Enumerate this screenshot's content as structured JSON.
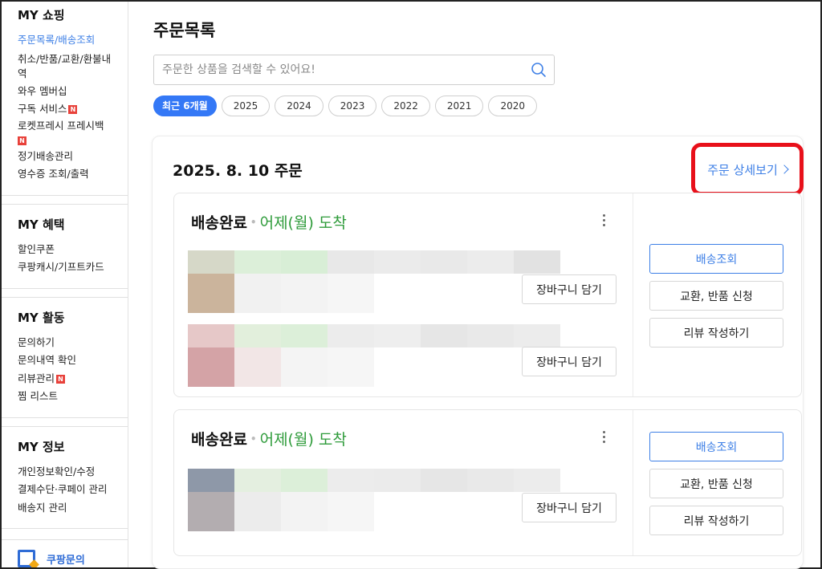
{
  "sidebar": {
    "sections": [
      {
        "title": "MY 쇼핑",
        "items": [
          "주문목록/배송조회",
          "취소/반품/교환/환불내역",
          "와우 멤버십",
          "구독 서비스",
          "로켓프레시 프레시백",
          "정기배송관리",
          "영수증 조회/출력"
        ]
      },
      {
        "title": "MY 혜택",
        "items": [
          "할인쿠폰",
          "쿠팡캐시/기프트카드"
        ]
      },
      {
        "title": "MY 활동",
        "items": [
          "문의하기",
          "문의내역 확인",
          "리뷰관리",
          "찜 리스트"
        ]
      },
      {
        "title": "MY 정보",
        "items": [
          "개인정보확인/수정",
          "결제수단·쿠페이 관리",
          "배송지 관리"
        ]
      }
    ],
    "new_badge": "N",
    "bottom_label": "쿠팡문의"
  },
  "main": {
    "title": "주문목록",
    "search_placeholder": "주문한 상품을 검색할 수 있어요!",
    "periods": [
      "최근 6개월",
      "2025",
      "2024",
      "2023",
      "2022",
      "2021",
      "2020"
    ],
    "order": {
      "date": "2025. 8. 10 주문",
      "detail_link": "주문 상세보기",
      "shipments": [
        {
          "status": "배송완료",
          "eta": "어제(월) 도착",
          "cart_buttons": [
            "장바구니 담기",
            "장바구니 담기"
          ],
          "actions": [
            "배송조회",
            "교환, 반품 신청",
            "리뷰 작성하기"
          ]
        },
        {
          "status": "배송완료",
          "eta": "어제(월) 도착",
          "cart_buttons": [
            "장바구니 담기"
          ],
          "actions": [
            "배송조회",
            "교환, 반품 신청",
            "리뷰 작성하기"
          ]
        }
      ]
    }
  },
  "colors": {
    "accent_blue": "#3d7fe6",
    "delivered_green": "#2e9b3a",
    "highlight_red": "#e8101a",
    "badge_red": "#e8413a"
  }
}
